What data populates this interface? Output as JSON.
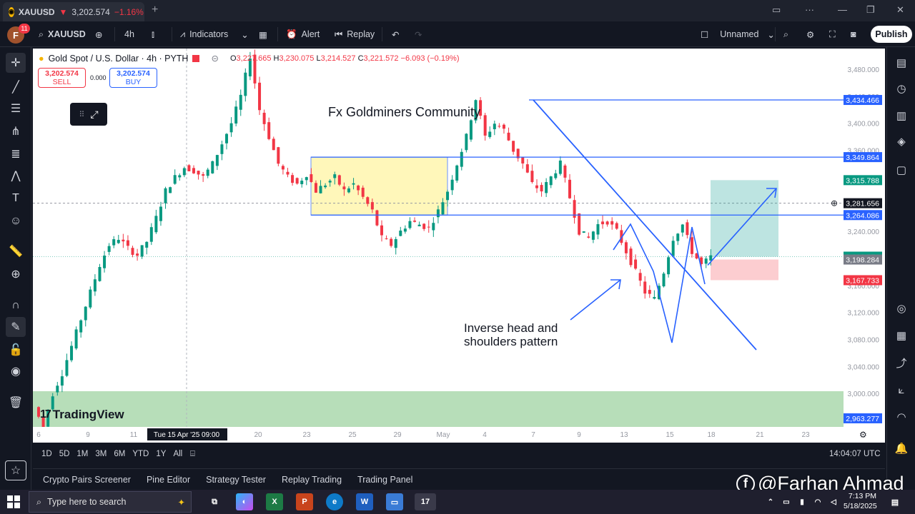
{
  "browser": {
    "tab_symbol": "XAUUSD",
    "tab_arrow": "▼",
    "tab_price": "3,202.574",
    "tab_change": "−1.16%"
  },
  "toolbar": {
    "avatar_letter": "F",
    "avatar_badge": "11",
    "symbol": "XAUUSD",
    "interval": "4h",
    "indicators_label": "Indicators",
    "alert_label": "Alert",
    "replay_label": "Replay",
    "layout_name": "Unnamed",
    "publish_label": "Publish"
  },
  "legend": {
    "title": "Gold Spot / U.S. Dollar · 4h · PYTH",
    "o_label": "O",
    "o": "3,227.665",
    "h_label": "H",
    "h": "3,230.075",
    "l_label": "L",
    "l": "3,214.527",
    "c_label": "C",
    "c": "3,221.572",
    "change": "−6.093 (−0.19%)"
  },
  "trade": {
    "sell_price": "3,202.574",
    "sell_label": "SELL",
    "spread": "0.000",
    "buy_price": "3,202.574",
    "buy_label": "BUY"
  },
  "watermark": "TradingView",
  "chart_data": {
    "type": "candlestick",
    "title": "Gold Spot / U.S. Dollar · 4h · PYTH",
    "ylim": [
      2940,
      3500
    ],
    "y_ticks": [
      3000,
      3040,
      3080,
      3120,
      3160,
      3200,
      3240,
      3280,
      3320,
      3360,
      3400,
      3440,
      3480
    ],
    "y_tick_labels": [
      "3,000.000",
      "3,040.000",
      "3,080.000",
      "3,120.000",
      "3,160.000",
      "3,200.000",
      "3,240.000",
      "3,280.000",
      "3,320.000",
      "3,360.000",
      "3,400.000",
      "3,440.000",
      "3,480.000"
    ],
    "x_tick_labels": [
      "6",
      "9",
      "11",
      "Tue 15 Apr '25",
      "20",
      "23",
      "25",
      "29",
      "May",
      "4",
      "7",
      "9",
      "13",
      "15",
      "18",
      "21",
      "23"
    ],
    "crosshair_time": "09:00",
    "price_path": [
      2980,
      2950,
      3000,
      3030,
      3070,
      3110,
      3150,
      3190,
      3220,
      3230,
      3215,
      3205,
      3225,
      3260,
      3300,
      3320,
      3335,
      3330,
      3320,
      3340,
      3370,
      3400,
      3440,
      3500,
      3420,
      3380,
      3340,
      3320,
      3310,
      3325,
      3300,
      3310,
      3320,
      3300,
      3310,
      3290,
      3270,
      3230,
      3220,
      3240,
      3255,
      3250,
      3245,
      3270,
      3300,
      3340,
      3380,
      3436,
      3380,
      3400,
      3390,
      3360,
      3340,
      3310,
      3300,
      3320,
      3340,
      3290,
      3240,
      3230,
      3250,
      3255,
      3240,
      3210,
      3180,
      3150,
      3140,
      3180,
      3230,
      3250,
      3210,
      3190,
      3202
    ],
    "price_labels": [
      {
        "value": 3434.466,
        "label": "3,434.466",
        "color": "#2962ff"
      },
      {
        "value": 3349.864,
        "label": "3,349.864",
        "color": "#2962ff"
      },
      {
        "value": 3315.788,
        "label": "3,315.788",
        "color": "#089981"
      },
      {
        "value": 3281.656,
        "label": "3,281.656",
        "color": "#131722"
      },
      {
        "value": 3264.086,
        "label": "3,264.086",
        "color": "#2962ff"
      },
      {
        "value": 3202.574,
        "label": "3,202.574",
        "color": "#089981"
      },
      {
        "value": 3198.284,
        "label": "3,198.284",
        "color": "#787b86"
      },
      {
        "value": 3167.733,
        "label": "3,167.733",
        "color": "#f23645"
      },
      {
        "value": 2963.277,
        "label": "2,963.277",
        "color": "#2962ff"
      }
    ],
    "horizontal_lines": [
      3434.466,
      3349.864,
      3264.086
    ],
    "annotations": [
      "Fx Goldminers Community",
      "Inverse head and",
      "shoulders pattern"
    ]
  },
  "rangebar": {
    "ranges": [
      "1D",
      "5D",
      "1M",
      "3M",
      "6M",
      "YTD",
      "1Y",
      "All"
    ],
    "clock": "14:04:07 UTC"
  },
  "panels": [
    "Crypto Pairs Screener",
    "Pine Editor",
    "Strategy Tester",
    "Replay Trading",
    "Trading Panel"
  ],
  "taskbar": {
    "search_placeholder": "Type here to search",
    "time": "7:13 PM",
    "date": "5/18/2025"
  },
  "credit": "@Farhan Ahmad",
  "colors": {
    "up": "#089981",
    "down": "#f23645",
    "line": "#2962ff",
    "accent": "#2962ff"
  }
}
